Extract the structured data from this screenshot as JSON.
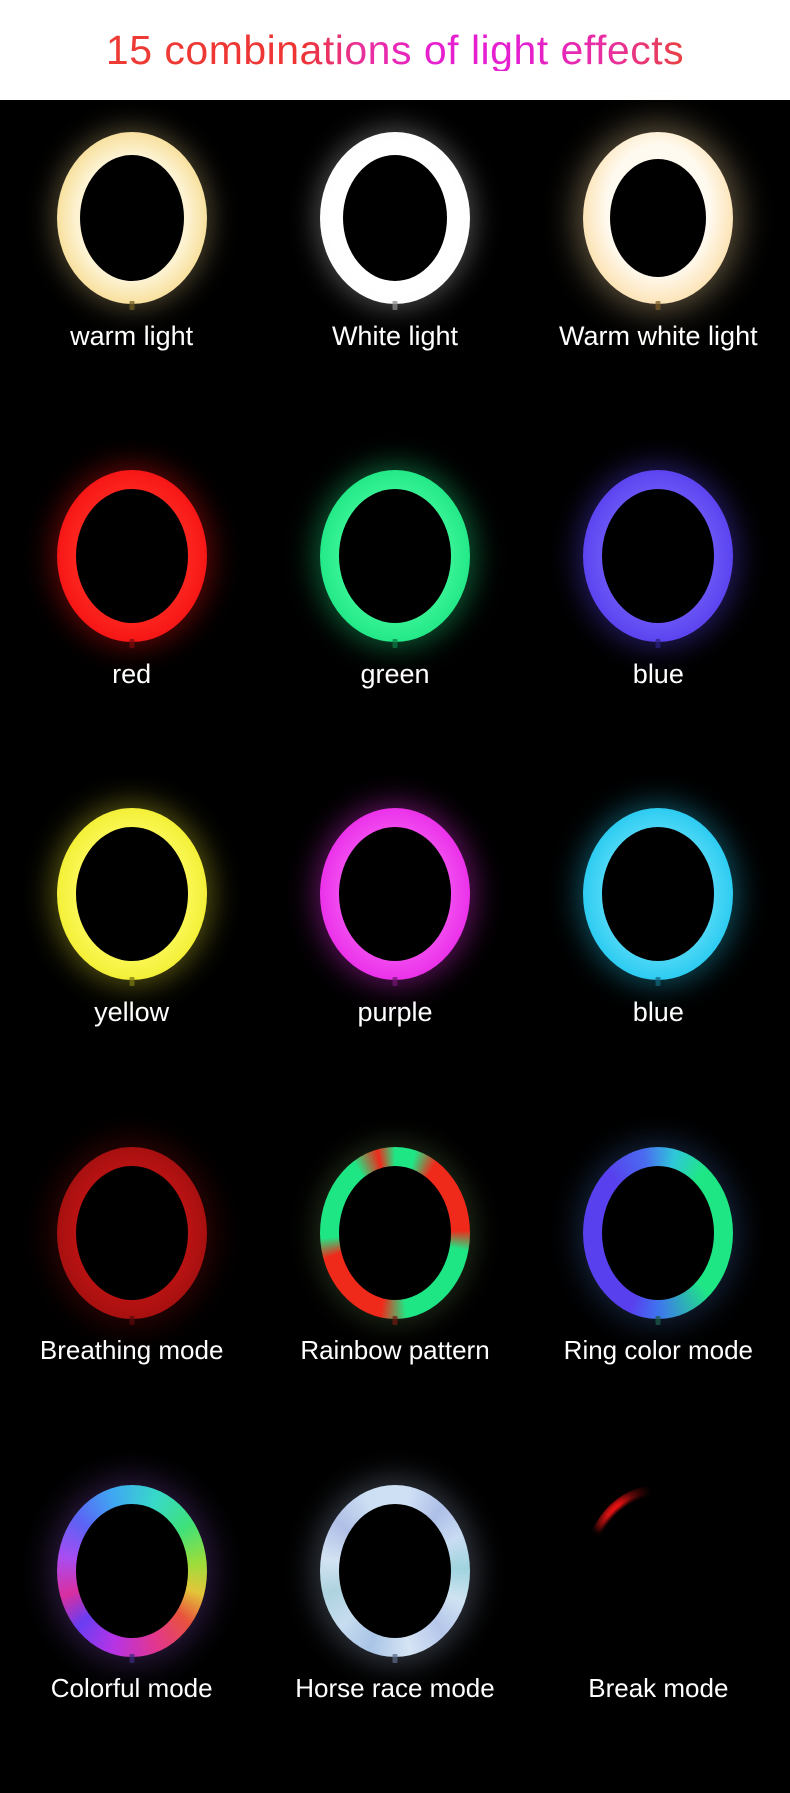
{
  "header": {
    "title": "15 combinations of light effects",
    "gradient_start": "#ee3b35",
    "gradient_mid": "#e721cf",
    "gradient_end": "#e8413f",
    "background": "#ffffff"
  },
  "board": {
    "background": "#000000",
    "label_color": "#ffffff",
    "columns": 3,
    "rows": 5,
    "total_effects": 15
  },
  "effects": [
    {
      "label": "warm light",
      "color": "#f5dc93",
      "style": "solid"
    },
    {
      "label": "White light",
      "color": "#ffffff",
      "style": "solid"
    },
    {
      "label": "Warm white light",
      "color": "#fbdfae",
      "style": "solid"
    },
    {
      "label": "red",
      "color": "#f41313",
      "style": "solid"
    },
    {
      "label": "green",
      "color": "#1fe685",
      "style": "solid"
    },
    {
      "label": "blue",
      "color": "#5840ee",
      "style": "solid"
    },
    {
      "label": "yellow",
      "color": "#f2ee30",
      "style": "solid"
    },
    {
      "label": "purple",
      "color": "#e92ce8",
      "style": "solid"
    },
    {
      "label": "blue",
      "color": "#25c9f0",
      "style": "solid"
    },
    {
      "label": "Breathing mode",
      "color": "#a00f0f",
      "style": "dim-glow"
    },
    {
      "label": "Rainbow pattern",
      "color": "#ef2a1b",
      "style": "segmented"
    },
    {
      "label": "Ring color mode",
      "color": "#5840ee",
      "style": "gradient"
    },
    {
      "label": "Colorful mode",
      "color": "#a84df2",
      "style": "rainbow"
    },
    {
      "label": "Horse race mode",
      "color": "#cfe0f5",
      "style": "chase"
    },
    {
      "label": "Break mode",
      "color": "#e21414",
      "style": "partial-arc"
    }
  ]
}
